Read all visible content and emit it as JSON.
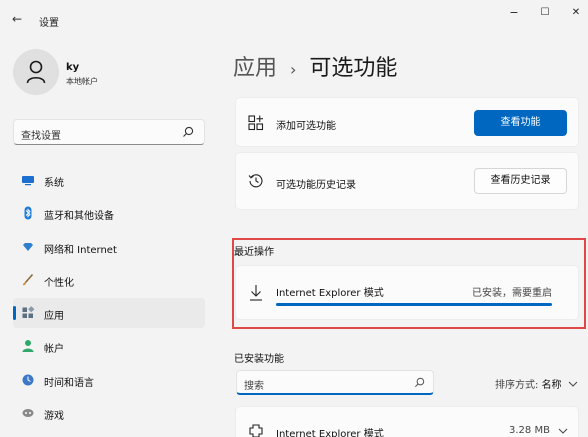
{
  "window": {
    "title": "设置",
    "back_glyph": "←",
    "minimize_glyph": "−",
    "maximize_glyph": "☐",
    "close_glyph": "✕"
  },
  "profile": {
    "name": "ky",
    "account_type": "本地帐户",
    "avatar_icon": "person-icon"
  },
  "search": {
    "placeholder": "查找设置",
    "icon": "search-icon"
  },
  "sidebar": {
    "items": [
      {
        "label": "系统",
        "icon": "monitor-icon",
        "color": "#1a6fd1"
      },
      {
        "label": "蓝牙和其他设备",
        "icon": "bluetooth-icon",
        "color": "#1f7bd6"
      },
      {
        "label": "网络和 Internet",
        "icon": "wifi-diamond-icon",
        "color": "#2f7fcf"
      },
      {
        "label": "个性化",
        "icon": "brush-icon",
        "color": "#d08a2c"
      },
      {
        "label": "应用",
        "icon": "apps-icon",
        "color": "#5d6f82",
        "active": true
      },
      {
        "label": "帐户",
        "icon": "account-icon",
        "color": "#2fa86a"
      },
      {
        "label": "时间和语言",
        "icon": "globe-clock-icon",
        "color": "#3d78c7"
      },
      {
        "label": "游戏",
        "icon": "gamepad-icon",
        "color": "#8a8a8a"
      }
    ]
  },
  "main": {
    "breadcrumb_parent": "应用",
    "breadcrumb_sep": "›",
    "breadcrumb_current": "可选功能",
    "add_feature": {
      "label": "添加可选功能",
      "button": "查看功能"
    },
    "history": {
      "label": "可选功能历史记录",
      "button": "查看历史记录"
    },
    "recent": {
      "heading": "最近操作",
      "item_label": "Internet Explorer 模式",
      "status": "已安装，需要重启",
      "progress": 1.0
    },
    "installed": {
      "heading": "已安装功能",
      "search_placeholder": "搜索",
      "sort_prefix": "排序方式:",
      "sort_value": "名称",
      "item_label": "Internet Explorer 模式",
      "item_size": "3.28 MB"
    }
  },
  "colors": {
    "accent": "#0067c0",
    "highlight": "#e04848",
    "background": "#f3f3f3",
    "card": "#fbfbfb"
  }
}
